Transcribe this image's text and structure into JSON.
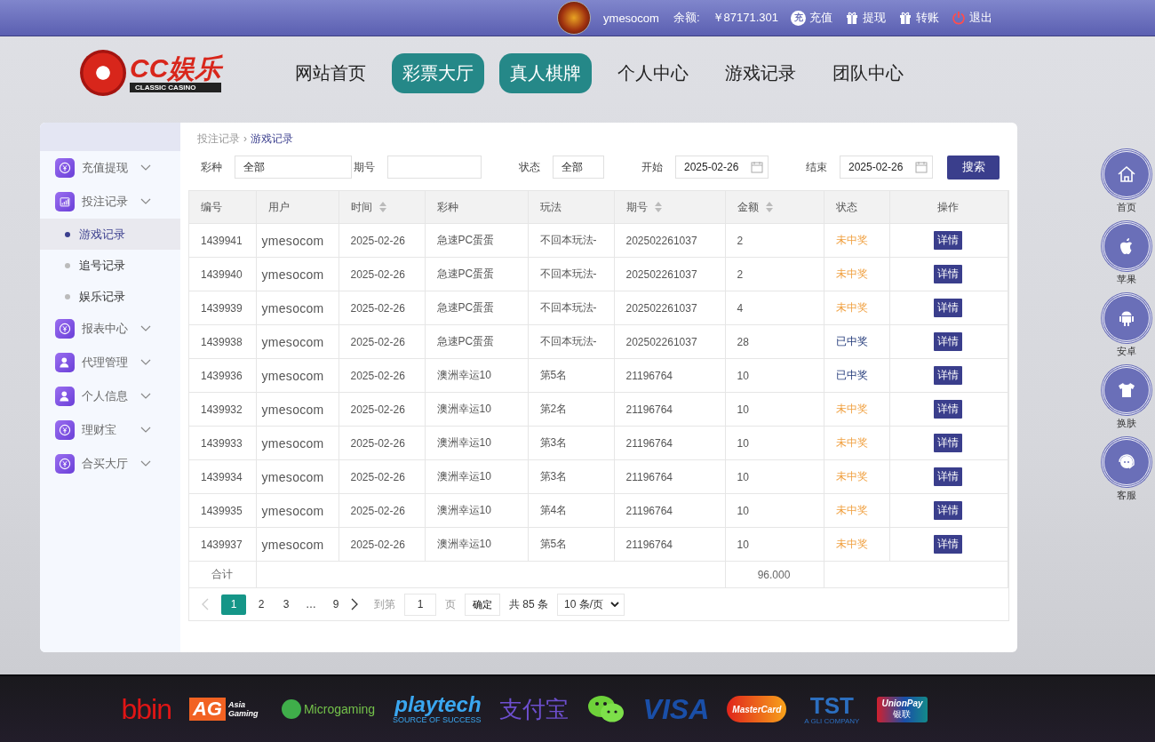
{
  "top_bar": {
    "username": "ymesocom",
    "balance_label": "余额:",
    "balance": "￥87171.301",
    "links": [
      {
        "kind": "charge",
        "icon_text": "充",
        "label": "充值"
      },
      {
        "kind": "gift",
        "label": "提现"
      },
      {
        "kind": "gift",
        "label": "转账"
      },
      {
        "kind": "power",
        "label": "退出"
      }
    ]
  },
  "logo": {
    "title": "CC娱乐",
    "subtitle": "CLASSIC CASINO"
  },
  "nav": [
    {
      "label": "网站首页",
      "highlighted": false
    },
    {
      "label": "彩票大厅",
      "highlighted": true
    },
    {
      "label": "真人棋牌",
      "highlighted": true
    },
    {
      "label": "个人中心",
      "highlighted": false
    },
    {
      "label": "游戏记录",
      "highlighted": false
    },
    {
      "label": "团队中心",
      "highlighted": false
    }
  ],
  "breadcrumb": [
    "投注记录",
    "游戏记录"
  ],
  "breadcrumb_separator": "›",
  "sidebar": {
    "items": [
      {
        "label": "充值提现",
        "kind": "yen"
      },
      {
        "label": "投注记录",
        "kind": "chart",
        "children": [
          {
            "label": "游戏记录",
            "selected": true
          },
          {
            "label": "追号记录",
            "selected": false
          },
          {
            "label": "娱乐记录",
            "selected": false
          }
        ]
      },
      {
        "label": "报表中心",
        "kind": "yen"
      },
      {
        "label": "代理管理",
        "kind": "agent"
      },
      {
        "label": "个人信息",
        "kind": "person"
      },
      {
        "label": "理财宝",
        "kind": "yen"
      },
      {
        "label": "合买大厅",
        "kind": "yen"
      }
    ]
  },
  "filters": {
    "lottery": {
      "label": "彩种",
      "value": "全部"
    },
    "issue": {
      "label": "期号"
    },
    "status": {
      "label": "状态",
      "value": "全部"
    },
    "start": {
      "label": "开始",
      "value": "2025-02-26"
    },
    "end": {
      "label": "结束",
      "value": "2025-02-26"
    },
    "search_button": "搜索"
  },
  "table": {
    "columns": [
      {
        "label": "编号",
        "sortable": false
      },
      {
        "label": "用户",
        "sortable": false
      },
      {
        "label": "时间",
        "sortable": true
      },
      {
        "label": "彩种",
        "sortable": false
      },
      {
        "label": "玩法",
        "sortable": false
      },
      {
        "label": "期号",
        "sortable": true
      },
      {
        "label": "金额",
        "sortable": true
      },
      {
        "label": "状态",
        "sortable": false
      },
      {
        "label": "操作",
        "sortable": false
      }
    ],
    "rows": [
      {
        "id": "1439941",
        "user": "ymesocom",
        "time": "2025-02-26",
        "lottery": "急速PC蛋蛋",
        "play": "不回本玩法-",
        "issue": "202502261037",
        "amount": "2",
        "status": "未中奖",
        "won": false,
        "action": "详情"
      },
      {
        "id": "1439940",
        "user": "ymesocom",
        "time": "2025-02-26",
        "lottery": "急速PC蛋蛋",
        "play": "不回本玩法-",
        "issue": "202502261037",
        "amount": "2",
        "status": "未中奖",
        "won": false,
        "action": "详情"
      },
      {
        "id": "1439939",
        "user": "ymesocom",
        "time": "2025-02-26",
        "lottery": "急速PC蛋蛋",
        "play": "不回本玩法-",
        "issue": "202502261037",
        "amount": "4",
        "status": "未中奖",
        "won": false,
        "action": "详情"
      },
      {
        "id": "1439938",
        "user": "ymesocom",
        "time": "2025-02-26",
        "lottery": "急速PC蛋蛋",
        "play": "不回本玩法-",
        "issue": "202502261037",
        "amount": "28",
        "status": "已中奖",
        "won": true,
        "action": "详情"
      },
      {
        "id": "1439936",
        "user": "ymesocom",
        "time": "2025-02-26",
        "lottery": "澳洲幸运10",
        "play": "第5名",
        "issue": "21196764",
        "amount": "10",
        "status": "已中奖",
        "won": true,
        "action": "详情"
      },
      {
        "id": "1439932",
        "user": "ymesocom",
        "time": "2025-02-26",
        "lottery": "澳洲幸运10",
        "play": "第2名",
        "issue": "21196764",
        "amount": "10",
        "status": "未中奖",
        "won": false,
        "action": "详情"
      },
      {
        "id": "1439933",
        "user": "ymesocom",
        "time": "2025-02-26",
        "lottery": "澳洲幸运10",
        "play": "第3名",
        "issue": "21196764",
        "amount": "10",
        "status": "未中奖",
        "won": false,
        "action": "详情"
      },
      {
        "id": "1439934",
        "user": "ymesocom",
        "time": "2025-02-26",
        "lottery": "澳洲幸运10",
        "play": "第3名",
        "issue": "21196764",
        "amount": "10",
        "status": "未中奖",
        "won": false,
        "action": "详情"
      },
      {
        "id": "1439935",
        "user": "ymesocom",
        "time": "2025-02-26",
        "lottery": "澳洲幸运10",
        "play": "第4名",
        "issue": "21196764",
        "amount": "10",
        "status": "未中奖",
        "won": false,
        "action": "详情"
      },
      {
        "id": "1439937",
        "user": "ymesocom",
        "time": "2025-02-26",
        "lottery": "澳洲幸运10",
        "play": "第5名",
        "issue": "21196764",
        "amount": "10",
        "status": "未中奖",
        "won": false,
        "action": "详情"
      }
    ],
    "total": {
      "label": "合计",
      "amount": "96.000"
    }
  },
  "pagination": {
    "prev_disabled": true,
    "pages": [
      {
        "label": "1",
        "selected": true
      },
      {
        "label": "2",
        "selected": false
      },
      {
        "label": "3",
        "selected": false
      },
      {
        "label": "…",
        "selected": false
      },
      {
        "label": "9",
        "selected": false
      }
    ],
    "goto_label": "到第",
    "goto_value": "1",
    "page_unit": "页",
    "confirm": "确定",
    "total": "共 85 条",
    "page_size": "10 条/页"
  },
  "side_buttons": [
    {
      "kind": "home",
      "label": "首页"
    },
    {
      "kind": "apple",
      "label": "苹果"
    },
    {
      "kind": "android",
      "label": "安卓"
    },
    {
      "kind": "shirt",
      "label": "换肤"
    },
    {
      "kind": "service",
      "label": "客服"
    }
  ],
  "footer_logos": [
    {
      "kind": "bbin",
      "text": "bbin"
    },
    {
      "kind": "ag",
      "text": "AG",
      "subtext": "Asia Gaming"
    },
    {
      "kind": "micro",
      "text": "Microgaming"
    },
    {
      "kind": "playtech",
      "text": "playtech",
      "subtext": "SOURCE OF SUCCESS"
    },
    {
      "kind": "alipay",
      "text": "支付宝"
    },
    {
      "kind": "wechat"
    },
    {
      "kind": "visa",
      "text": "VISA"
    },
    {
      "kind": "master",
      "text": "MasterCard"
    },
    {
      "kind": "tst",
      "text": "TST",
      "subtext": "A GLI COMPANY"
    },
    {
      "kind": "union",
      "text": "UnionPay",
      "subtext": "银联"
    }
  ]
}
